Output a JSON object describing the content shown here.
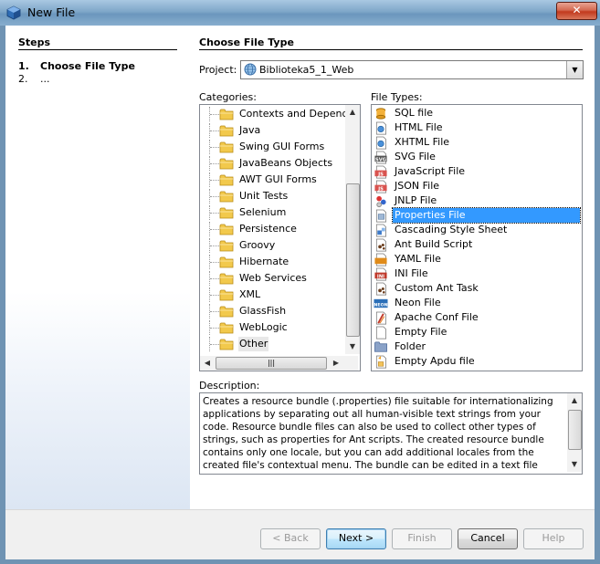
{
  "window": {
    "title": "New File",
    "close_glyph": "✕"
  },
  "steps": {
    "title": "Steps",
    "items": [
      {
        "num": "1.",
        "label": "Choose File Type"
      },
      {
        "num": "2.",
        "label": "..."
      }
    ]
  },
  "main": {
    "title": "Choose File Type",
    "project_label": "Project:",
    "project_value": "Biblioteka5_1_Web",
    "categories_label": "Categories:",
    "file_types_label": "File Types:",
    "categories": [
      "Contexts and Dependency Injection",
      "Java",
      "Swing GUI Forms",
      "JavaBeans Objects",
      "AWT GUI Forms",
      "Unit Tests",
      "Selenium",
      "Persistence",
      "Groovy",
      "Hibernate",
      "Web Services",
      "XML",
      "GlassFish",
      "WebLogic",
      "Other"
    ],
    "selected_category": "Other",
    "file_types": [
      {
        "label": "SQL file",
        "icon": "sql-file-icon"
      },
      {
        "label": "HTML File",
        "icon": "html-file-icon"
      },
      {
        "label": "XHTML File",
        "icon": "xhtml-file-icon"
      },
      {
        "label": "SVG File",
        "icon": "svg-file-icon",
        "icon_text": "SVG"
      },
      {
        "label": "JavaScript File",
        "icon": "javascript-file-icon",
        "icon_text": "JS"
      },
      {
        "label": "JSON File",
        "icon": "json-file-icon",
        "icon_text": "JS"
      },
      {
        "label": "JNLP File",
        "icon": "jnlp-file-icon"
      },
      {
        "label": "Properties File",
        "icon": "properties-file-icon"
      },
      {
        "label": "Cascading Style Sheet",
        "icon": "css-file-icon"
      },
      {
        "label": "Ant Build Script",
        "icon": "ant-build-script-icon"
      },
      {
        "label": "YAML File",
        "icon": "yaml-file-icon"
      },
      {
        "label": "INI File",
        "icon": "ini-file-icon",
        "icon_text": "INI"
      },
      {
        "label": "Custom Ant Task",
        "icon": "custom-ant-task-icon"
      },
      {
        "label": "Neon File",
        "icon": "neon-file-icon",
        "icon_text": "NEON"
      },
      {
        "label": "Apache Conf File",
        "icon": "apache-conf-file-icon"
      },
      {
        "label": "Empty File",
        "icon": "empty-file-icon"
      },
      {
        "label": "Folder",
        "icon": "folder-icon"
      },
      {
        "label": "Empty Apdu file",
        "icon": "apdu-file-icon"
      }
    ],
    "selected_file_type": "Properties File",
    "description_label": "Description:",
    "description": "Creates a resource bundle (.properties) file suitable for internationalizing applications by separating out all human-visible text strings from your code. Resource bundle files can also be used to collect other types of strings, such as properties for Ant scripts. The created resource bundle contains only one locale, but you can add additional locales from the created file's contextual menu. The bundle can be edited in a text file (property-file format) for a specific locale or in"
  },
  "buttons": {
    "back": "< Back",
    "next": "Next >",
    "finish": "Finish",
    "cancel": "Cancel",
    "help": "Help"
  },
  "colors": {
    "selection": "#3399ff",
    "folder": "#f2c94c",
    "title_bar": "#7fa7c9"
  }
}
